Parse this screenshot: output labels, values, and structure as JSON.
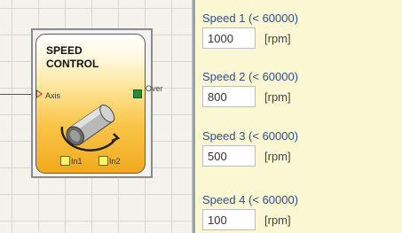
{
  "block": {
    "title_line1": "SPEED",
    "title_line2": "CONTROL",
    "input_axis": "Axis",
    "output_over": "Over",
    "input_1": "In1",
    "input_2": "In2"
  },
  "panel": {
    "speeds": [
      {
        "label": "Speed 1 (< 60000)",
        "value": "1000",
        "unit": "[rpm]"
      },
      {
        "label": "Speed 2 (< 60000)",
        "value": "800",
        "unit": "[rpm]"
      },
      {
        "label": "Speed 3 (< 60000)",
        "value": "500",
        "unit": "[rpm]"
      },
      {
        "label": "Speed 4 (< 60000)",
        "value": "100",
        "unit": "[rpm]"
      }
    ]
  },
  "colors": {
    "panel_bg": "#fbf7d2",
    "label_blue": "#2c4f8a",
    "block_orange": "#f2a91c",
    "axis_port_red": "#e03030",
    "output_port_green": "#1f8f3a",
    "input_port_yellow": "#fff56a"
  },
  "icons": {
    "block_icon": "rotating-shaft-icon"
  }
}
